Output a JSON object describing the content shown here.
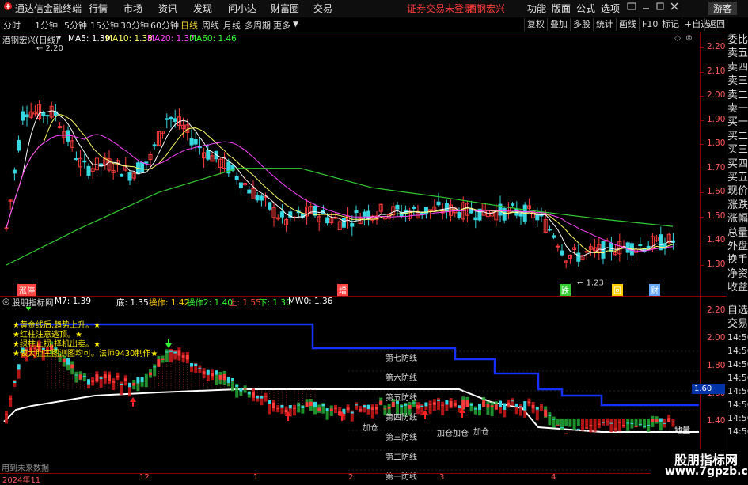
{
  "menubar": {
    "app_title": "通达信金融终端",
    "menus": [
      "行情",
      "市场",
      "资讯",
      "发现",
      "问小达",
      "财富圈",
      "交易"
    ],
    "warning": "证券交易未登录",
    "stock_name": "酒钢宏兴",
    "right_menus": [
      "功能",
      "版面",
      "公式",
      "选项"
    ],
    "guest": "游客"
  },
  "periodbar": {
    "periods": [
      "分时",
      "1分钟",
      "5分钟",
      "15分钟",
      "30分钟",
      "60分钟",
      "日线",
      "周线",
      "月线",
      "多周期",
      "更多"
    ],
    "active": "日线",
    "right_buttons": [
      "复权",
      "叠加",
      "多股",
      "统计",
      "画线",
      "F10",
      "标记",
      "+自选",
      "返回"
    ]
  },
  "main": {
    "title": "酒钢宏兴(日线)",
    "ma": [
      {
        "label": "MA5: 1.39",
        "color": "#ffffff"
      },
      {
        "label": "MA10: 1.38",
        "color": "#ffff66"
      },
      {
        "label": "MA20: 1.37",
        "color": "#ff44ff"
      },
      {
        "label": "MA60: 1.46",
        "color": "#33ff33"
      }
    ],
    "y_ticks": [
      "2.20",
      "2.10",
      "2.00",
      "1.90",
      "1.80",
      "1.70",
      "1.60",
      "1.50",
      "1.40",
      "1.30"
    ],
    "high_label": "2.20",
    "low_label": "1.23",
    "badges": [
      {
        "text": "涨停",
        "color": "#ff4444"
      },
      {
        "text": "增",
        "color": "#ff4444"
      },
      {
        "text": "跌",
        "color": "#33cc33"
      },
      {
        "text": "回",
        "color": "#ffcc00"
      },
      {
        "text": "财",
        "color": "#66aaff"
      }
    ]
  },
  "sub": {
    "title": "股朋指标网",
    "params": [
      {
        "label": "M7: 1.39",
        "color": "#ffffff"
      },
      {
        "label": "底: 1.35",
        "color": "#ffffff"
      },
      {
        "label": "操作: 1.42",
        "color": "#ffcc00"
      },
      {
        "label": "操作2: 1.40",
        "color": "#33ff33"
      },
      {
        "label": "上: 1.55",
        "color": "#ff4444"
      },
      {
        "label": "下: 1.30",
        "color": "#33ff33"
      },
      {
        "label": "MW0: 1.36",
        "color": "#ffffff"
      }
    ],
    "notes": [
      "★黄金线后,趋势上升。★",
      "★红柱注意逃顶。★",
      "★绿柱止损,择机出卖。★",
      "★做大胆主图测图均可。法师9430制作★"
    ],
    "defense_lines": [
      "第七防线",
      "第六防线",
      "第五防线",
      "第四防线",
      "第三防线",
      "第二防线",
      "第一防线"
    ],
    "add_labels": [
      "加仓",
      "加仓",
      "加仓",
      "加仓"
    ],
    "ground_label": "地量",
    "y_ticks": [
      "2.20",
      "2.00",
      "1.80",
      "1.60",
      "1.40"
    ],
    "current_value": "1.60",
    "future_data": "用到未来数据"
  },
  "right_panel": [
    "委比",
    "卖五",
    "卖四",
    "卖三",
    "卖二",
    "卖一",
    "买一",
    "买二",
    "买三",
    "买四",
    "买五",
    "现价",
    "涨跌",
    "涨幅",
    "总量",
    "外盘",
    "换手",
    "净资",
    "收益"
  ],
  "right_panel2": [
    "自选",
    "交易",
    "14:56",
    "14:56",
    "14:56",
    "14:56",
    "14:56",
    "14:56",
    "14:56",
    "14:56"
  ],
  "xaxis": {
    "labels": [
      "2024年11",
      "12",
      "1",
      "2",
      "3",
      "4"
    ]
  },
  "watermark": {
    "line1": "股朋指标网",
    "line2": "www.7gpzb.com"
  },
  "colors": {
    "up": "#ff3b3b",
    "down": "#36d7e0",
    "ma60": "#33cc33"
  }
}
